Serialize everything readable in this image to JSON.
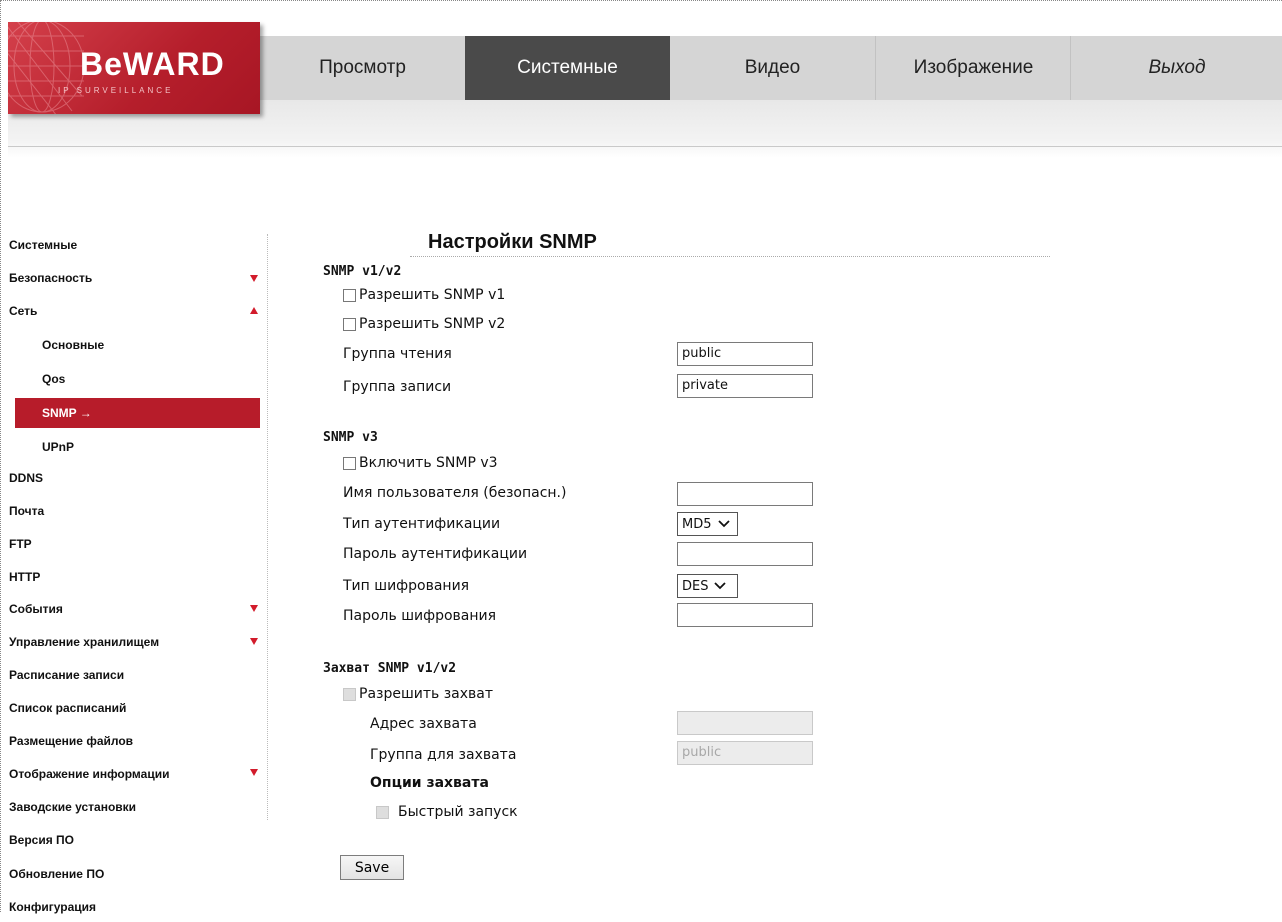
{
  "logo": {
    "text": "BeWARD",
    "subtitle": "IP SURVEILLANCE"
  },
  "nav": {
    "items": [
      {
        "label": "Просмотр"
      },
      {
        "label": "Системные"
      },
      {
        "label": "Видео"
      },
      {
        "label": "Изображение"
      },
      {
        "label": "Выход"
      }
    ],
    "active": "Системные"
  },
  "sidebar": {
    "items": [
      {
        "label": "Системные"
      },
      {
        "label": "Безопасность",
        "arrow": "down"
      },
      {
        "label": "Сеть",
        "arrow": "up"
      },
      {
        "label": "Основные"
      },
      {
        "label": "Qos"
      },
      {
        "label": "SNMP →",
        "active": true
      },
      {
        "label": "UPnP"
      },
      {
        "label": "DDNS"
      },
      {
        "label": "Почта"
      },
      {
        "label": "FTP"
      },
      {
        "label": "HTTP"
      },
      {
        "label": "События",
        "arrow": "down"
      },
      {
        "label": "Управление хранилищем",
        "arrow": "down"
      },
      {
        "label": "Расписание записи"
      },
      {
        "label": "Список расписаний"
      },
      {
        "label": "Размещение файлов"
      },
      {
        "label": "Отображение информации",
        "arrow": "down"
      },
      {
        "label": "Заводские установки"
      },
      {
        "label": "Версия ПО"
      },
      {
        "label": "Обновление ПО"
      },
      {
        "label": "Конфигурация"
      }
    ]
  },
  "main": {
    "title": "Настройки SNMP",
    "v12": {
      "heading": "SNMP v1/v2",
      "enable_v1": "Разрешить SNMP v1",
      "enable_v2": "Разрешить SNMP v2",
      "read_group_label": "Группа чтения",
      "read_group_value": "public",
      "write_group_label": "Группа записи",
      "write_group_value": "private"
    },
    "v3": {
      "heading": "SNMP v3",
      "enable": "Включить SNMP v3",
      "username_label": "Имя пользователя (безопасн.)",
      "username_value": "",
      "auth_type_label": "Тип аутентификации",
      "auth_type_value": "MD5",
      "auth_password_label": "Пароль аутентификации",
      "auth_password_value": "",
      "enc_type_label": "Тип шифрования",
      "enc_type_value": "DES",
      "enc_password_label": "Пароль шифрования",
      "enc_password_value": ""
    },
    "trap": {
      "heading": "Захват SNMP v1/v2",
      "enable": "Разрешить захват",
      "address_label": "Адрес захвата",
      "address_value": "",
      "group_label": "Группа для захвата",
      "group_value": "public",
      "options_heading": "Опции захвата",
      "fast_start": "Быстрый запуск"
    },
    "save_label": "Save"
  }
}
